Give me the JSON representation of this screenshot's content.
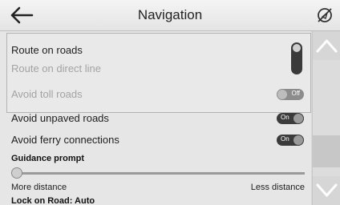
{
  "header": {
    "title": "Navigation",
    "back_icon": "arrow-left-icon",
    "location_icon": "location-off-icon"
  },
  "options": {
    "route_on_roads": "Route on roads",
    "route_on_direct_line": "Route on direct line",
    "avoid_toll_roads": {
      "label": "Avoid toll roads",
      "state": "Off"
    },
    "avoid_unpaved_roads": {
      "label": "Avoid unpaved roads",
      "state": "On"
    },
    "avoid_ferry_connections": {
      "label": "Avoid ferry connections",
      "state": "On"
    }
  },
  "guidance": {
    "label": "Guidance prompt",
    "min_label": "More distance",
    "max_label": "Less distance",
    "value_fraction": 0.0
  },
  "lock_on_road": "Lock on Road: Auto",
  "colors": {
    "header_bg": "#ececec",
    "content_bg": "#e6e6e6",
    "toggle_on": "#3b3b3b",
    "toggle_off": "#8c8c8c"
  }
}
